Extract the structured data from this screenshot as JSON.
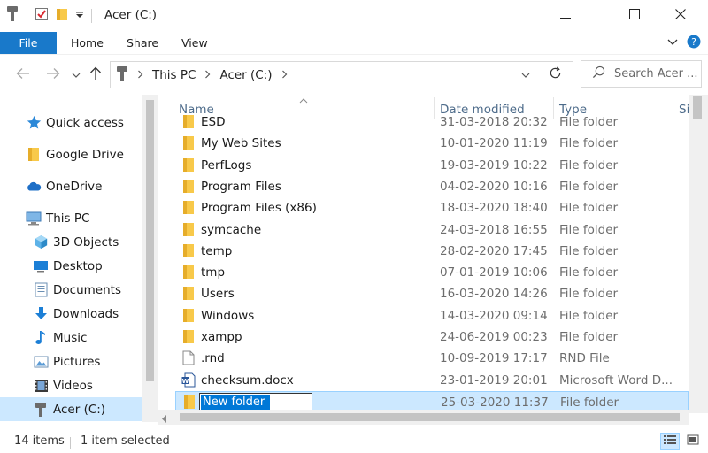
{
  "window": {
    "title": "Acer (C:)"
  },
  "ribbon": {
    "file": "File",
    "home": "Home",
    "share": "Share",
    "view": "View"
  },
  "address": {
    "root": "This PC",
    "current": "Acer (C:)",
    "search_placeholder": "Search Acer ..."
  },
  "sidebar": {
    "items": [
      {
        "label": "Quick access",
        "icon": "star-icon"
      },
      {
        "label": "Google Drive",
        "icon": "folder-icon"
      },
      {
        "label": "OneDrive",
        "icon": "cloud-icon"
      },
      {
        "label": "This PC",
        "icon": "computer-icon"
      },
      {
        "label": "3D Objects",
        "icon": "cube-icon"
      },
      {
        "label": "Desktop",
        "icon": "desktop-icon"
      },
      {
        "label": "Documents",
        "icon": "documents-icon"
      },
      {
        "label": "Downloads",
        "icon": "download-icon"
      },
      {
        "label": "Music",
        "icon": "music-icon"
      },
      {
        "label": "Pictures",
        "icon": "pictures-icon"
      },
      {
        "label": "Videos",
        "icon": "videos-icon"
      },
      {
        "label": "Acer (C:)",
        "icon": "drive-icon"
      }
    ]
  },
  "columns": {
    "name": "Name",
    "date": "Date modified",
    "type": "Type",
    "size": "Si"
  },
  "files": [
    {
      "name": "ESD",
      "date": "31-03-2018 20:32",
      "type": "File folder",
      "icon": "folder-icon"
    },
    {
      "name": "My Web Sites",
      "date": "10-01-2020 11:19",
      "type": "File folder",
      "icon": "folder-icon"
    },
    {
      "name": "PerfLogs",
      "date": "19-03-2019 10:22",
      "type": "File folder",
      "icon": "folder-icon"
    },
    {
      "name": "Program Files",
      "date": "04-02-2020 10:16",
      "type": "File folder",
      "icon": "folder-icon"
    },
    {
      "name": "Program Files (x86)",
      "date": "18-03-2020 18:40",
      "type": "File folder",
      "icon": "folder-icon"
    },
    {
      "name": "symcache",
      "date": "24-03-2018 16:55",
      "type": "File folder",
      "icon": "folder-icon"
    },
    {
      "name": "temp",
      "date": "28-02-2020 17:45",
      "type": "File folder",
      "icon": "folder-icon"
    },
    {
      "name": "tmp",
      "date": "07-01-2019 10:06",
      "type": "File folder",
      "icon": "folder-icon"
    },
    {
      "name": "Users",
      "date": "16-03-2020 14:26",
      "type": "File folder",
      "icon": "folder-icon"
    },
    {
      "name": "Windows",
      "date": "14-03-2020 09:14",
      "type": "File folder",
      "icon": "folder-icon"
    },
    {
      "name": "xampp",
      "date": "24-06-2019 00:23",
      "type": "File folder",
      "icon": "folder-icon"
    },
    {
      "name": ".rnd",
      "date": "10-09-2019 17:17",
      "type": "RND File",
      "icon": "file-icon"
    },
    {
      "name": "checksum.docx",
      "date": "23-01-2019 20:01",
      "type": "Microsoft Word D...",
      "icon": "word-doc-icon"
    }
  ],
  "new_folder": {
    "name": "New folder",
    "date": "25-03-2020 11:37",
    "type": "File folder"
  },
  "status": {
    "count": "14 items",
    "selection": "1 item selected"
  },
  "colors": {
    "accent": "#1979ca",
    "selection": "#cce8ff",
    "folder": "#f8c94a",
    "header_text": "#4d6b8a"
  }
}
